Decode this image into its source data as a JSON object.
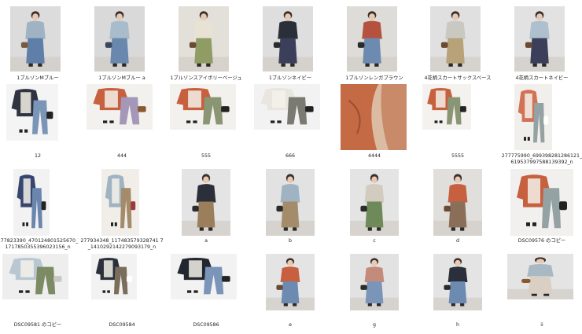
{
  "files": [
    {
      "name": "1ブルゾンMブルー",
      "kind": "person",
      "bg": "#dcdcdc",
      "top": "#9fb3c2",
      "bottom": "#5f7fa8",
      "bag": "#7a5a3a"
    },
    {
      "name": "1ブルゾンMブルー a",
      "kind": "person",
      "bg": "#d9d9d9",
      "top": "#a9bccb",
      "bottom": "#6a88ad",
      "bag": "#3a4660"
    },
    {
      "name": "1ブルゾンスアイボリーベージュ",
      "kind": "person",
      "bg": "#e3e0da",
      "top": "#e8e2d4",
      "bottom": "#8f9c64",
      "bag": "#6a4a30"
    },
    {
      "name": "1ブルゾンネイビー",
      "kind": "person",
      "bg": "#dedede",
      "top": "#2a2f3a",
      "bottom": "#3c3f5a",
      "bag": "#2b2b2b"
    },
    {
      "name": "1ブルゾンレンガブラウン",
      "kind": "person",
      "bg": "#dedcd8",
      "top": "#b4523f",
      "bottom": "#6d8ab0",
      "bag": "#2b2b2b"
    },
    {
      "name": "4花柄スカートサックスベース",
      "kind": "person",
      "bg": "#e0e0e0",
      "top": "#c9c9c2",
      "bottom": "#b7a27a",
      "bag": "#6a4a30"
    },
    {
      "name": "4花柄スカートネイビー",
      "kind": "person",
      "bg": "#e2e2e2",
      "top": "#aebfcd",
      "bottom": "#3c3f5a",
      "bag": "#6a4a30"
    },
    {
      "name": "12",
      "kind": "flat",
      "bg": "#f4f4f4",
      "top": "#2f3440",
      "bottom": "#7a95b8",
      "bag": "#222"
    },
    {
      "name": "444",
      "kind": "flat",
      "bg": "#f3f1ee",
      "top": "#c7603f",
      "bottom": "#a497b7",
      "bag": "#8a5a2f"
    },
    {
      "name": "555",
      "kind": "flat",
      "bg": "#f3f1ee",
      "top": "#c7603f",
      "bottom": "#8a9574",
      "bag": "#222"
    },
    {
      "name": "666",
      "kind": "flat",
      "bg": "#f2f2f2",
      "top": "#e9e6e0",
      "bottom": "#7a7a72",
      "bag": "#222"
    },
    {
      "name": "4444",
      "kind": "closeup",
      "bg": "#c98a6a",
      "top": "#c46a44",
      "bottom": "#dcbba3",
      "bag": "#b0603e"
    },
    {
      "name": "5555",
      "kind": "flat",
      "bg": "#f4f2ef",
      "top": "#c7603f",
      "bottom": "#8a9574",
      "bag": "#222"
    },
    {
      "name": "277775990_699398281286121_619537997588139392_n",
      "kind": "flat",
      "bg": "#f1efec",
      "top": "#d27155",
      "bottom": "#95a2a4",
      "bag": "#ffffff"
    },
    {
      "name": "277823390_470124801525670_1717850355396023156_n",
      "kind": "flat",
      "bg": "#f2f2f2",
      "top": "#37466e",
      "bottom": "#6a86ad",
      "bag": "#222"
    },
    {
      "name": "277934348_117483579328741 7_1410292142279093179_n",
      "kind": "flat",
      "bg": "#f1eeea",
      "top": "#9fb3c2",
      "bottom": "#a48b6a",
      "bag": "#9a3a3a"
    },
    {
      "name": "a",
      "kind": "person",
      "bg": "#e4e4e4",
      "top": "#2a2f3a",
      "bottom": "#9b7e5c",
      "bag": "#2b2b2b"
    },
    {
      "name": "b",
      "kind": "person",
      "bg": "#e2e2e2",
      "top": "#9fb3c2",
      "bottom": "#a48b6a",
      "bag": "#2b2b2b"
    },
    {
      "name": "c",
      "kind": "person",
      "bg": "#e4e4e4",
      "top": "#d2cbc0",
      "bottom": "#6f8a59",
      "bag": "#2b2b2b"
    },
    {
      "name": "d",
      "kind": "person",
      "bg": "#e0dfdc",
      "top": "#c7603f",
      "bottom": "#8a6e58",
      "bag": "#6a4a30"
    },
    {
      "name": "DSC09576 のコピー",
      "kind": "flat",
      "bg": "#f1f0ee",
      "top": "#c7603f",
      "bottom": "#95a2a4",
      "bag": "#222"
    },
    {
      "name": "DSC09581 のコピー",
      "kind": "flat",
      "bg": "#eeeeee",
      "top": "#b8c7d1",
      "bottom": "#7c8b63",
      "bag": "#c8c8c8"
    },
    {
      "name": "DSC09584",
      "kind": "flat",
      "bg": "#f2f2f2",
      "top": "#2a2f3a",
      "bottom": "#7a6e5a",
      "bag": "#fff"
    },
    {
      "name": "DSC09586",
      "kind": "flat",
      "bg": "#f2f2f2",
      "top": "#22262e",
      "bottom": "#7a95b8",
      "bag": "#222"
    },
    {
      "name": "e",
      "kind": "person",
      "bg": "#e4e4e4",
      "top": "#c7603f",
      "bottom": "#6d8ab0",
      "bag": "#6a4a30"
    },
    {
      "name": "g",
      "kind": "person",
      "bg": "#e2e2e2",
      "top": "#c58b7a",
      "bottom": "#7a95b8",
      "bag": "#2b2b2b"
    },
    {
      "name": "h",
      "kind": "person",
      "bg": "#e4e4e4",
      "top": "#2a2f3a",
      "bottom": "#6d8ab0",
      "bag": "#2b2b2b"
    },
    {
      "name": "ii",
      "kind": "person",
      "bg": "#e4e4e4",
      "top": "#a8b9c4",
      "bottom": "#d9cfc3",
      "bag": "#8a5a2f"
    }
  ]
}
